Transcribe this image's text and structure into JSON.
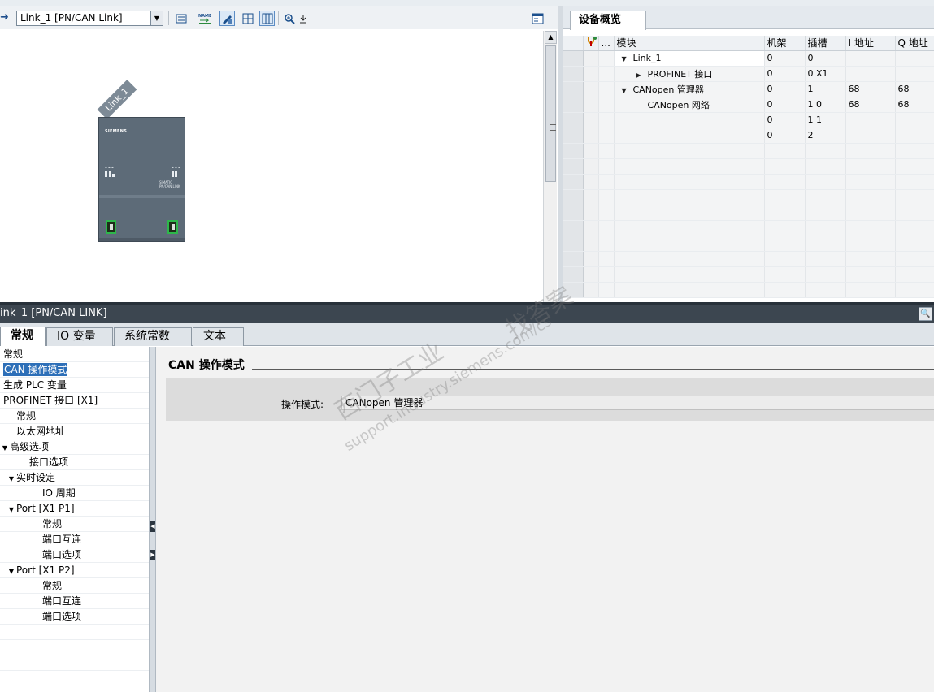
{
  "toolbar": {
    "device_select": "Link_1 [PN/CAN Link]",
    "icons": [
      "back-arrow-icon",
      "topology-icon",
      "name-icon",
      "device-edit-icon",
      "grid-icon",
      "table-icon",
      "zoom-icon",
      "download-icon",
      "overview-toggle-icon"
    ]
  },
  "canvas": {
    "device_label": "Link_1",
    "module_brand": "SIEMENS",
    "module_model_line1": "SIMATIC",
    "module_model_line2": "PN/CAN LINK"
  },
  "overview": {
    "tab": "设备概览",
    "columns": [
      "",
      "...",
      "模块",
      "机架",
      "插槽",
      "I 地址",
      "Q 地址"
    ],
    "rows": [
      {
        "module": "Link_1",
        "indent": 1,
        "expand": "down",
        "rack": "0",
        "slot": "0",
        "i_addr": "",
        "q_addr": ""
      },
      {
        "module": "PROFINET 接口",
        "indent": 2,
        "expand": "right",
        "rack": "0",
        "slot": "0 X1",
        "i_addr": "",
        "q_addr": ""
      },
      {
        "module": "CANopen 管理器",
        "indent": 1,
        "expand": "down",
        "rack": "0",
        "slot": "1",
        "i_addr": "68",
        "q_addr": "68"
      },
      {
        "module": "CANopen 网络",
        "indent": 2,
        "expand": "",
        "rack": "0",
        "slot": "1 0",
        "i_addr": "68",
        "q_addr": "68"
      },
      {
        "module": "",
        "indent": 1,
        "expand": "",
        "rack": "0",
        "slot": "1 1",
        "i_addr": "",
        "q_addr": ""
      },
      {
        "module": "",
        "indent": 1,
        "expand": "",
        "rack": "0",
        "slot": "2",
        "i_addr": "",
        "q_addr": ""
      }
    ]
  },
  "inspector": {
    "title": "ink_1 [PN/CAN LINK]",
    "tabs": [
      "常规",
      "IO 变量",
      "系统常数",
      "文本"
    ],
    "nav": [
      {
        "label": "常规",
        "level": 0,
        "expand": ""
      },
      {
        "label": "CAN 操作模式",
        "level": 0,
        "expand": "",
        "selected": true
      },
      {
        "label": "生成 PLC 变量",
        "level": 0,
        "expand": ""
      },
      {
        "label": "PROFINET 接口 [X1]",
        "level": 0,
        "expand": ""
      },
      {
        "label": "常规",
        "level": 1,
        "expand": ""
      },
      {
        "label": "以太网地址",
        "level": 1,
        "expand": ""
      },
      {
        "label": "高级选项",
        "level": 0,
        "expand": "down"
      },
      {
        "label": "接口选项",
        "level": 2,
        "expand": ""
      },
      {
        "label": "实时设定",
        "level": 1,
        "expand": "down"
      },
      {
        "label": "IO 周期",
        "level": 3,
        "expand": ""
      },
      {
        "label": "Port [X1 P1]",
        "level": 1,
        "expand": "down"
      },
      {
        "label": "常规",
        "level": 3,
        "expand": ""
      },
      {
        "label": "端口互连",
        "level": 3,
        "expand": ""
      },
      {
        "label": "端口选项",
        "level": 3,
        "expand": ""
      },
      {
        "label": "Port [X1 P2]",
        "level": 1,
        "expand": "down"
      },
      {
        "label": "常规",
        "level": 3,
        "expand": ""
      },
      {
        "label": "端口互连",
        "level": 3,
        "expand": ""
      },
      {
        "label": "端口选项",
        "level": 3,
        "expand": ""
      }
    ],
    "section_title": "CAN 操作模式",
    "field_label": "操作模式:",
    "field_value": "CANopen 管理器"
  },
  "watermark": {
    "line1": "找答案",
    "line2": "support.industry.siemens.com/cs",
    "line3": "西门子工业"
  }
}
